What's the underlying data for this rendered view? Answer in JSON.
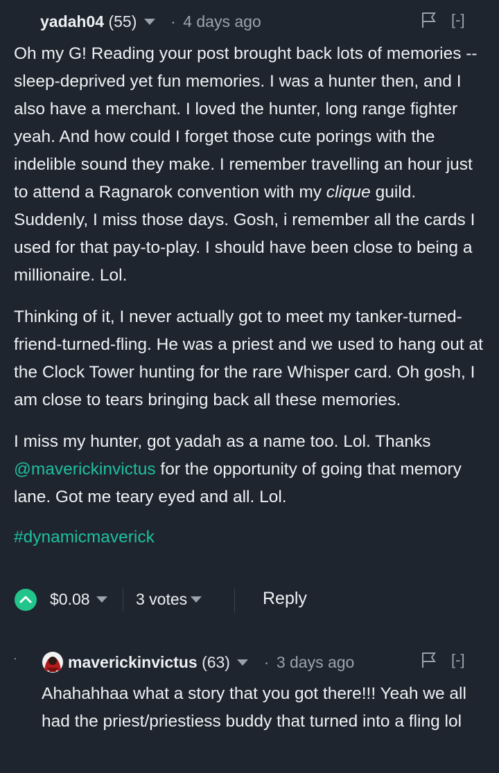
{
  "comment": {
    "author": "yadah04",
    "reputation": "(55)",
    "separator": "·",
    "time": "4 days ago",
    "collapse_label": "[-]",
    "paragraph1_before_italic": "Oh my G! Reading your post brought back lots of memories -- sleep-deprived yet fun memories. I was a hunter then, and I also have a merchant. I loved the hunter, long range fighter yeah. And how could I forget those cute porings with the indelible sound they make. I remember travelling an hour just to attend a Ragnarok convention with my ",
    "paragraph1_italic": "clique",
    "paragraph1_after_italic": " guild. Suddenly, I miss those days. Gosh, i remember all the cards I used for that pay-to-play. I should have been close to being a millionaire. Lol.",
    "paragraph2": "Thinking of it, I never actually got to meet my tanker-turned-friend-turned-fling. He was a priest and we used to hang out at the Clock Tower hunting for the rare Whisper card. Oh gosh, I am close to tears bringing back all these memories.",
    "paragraph3_before": "I miss my hunter, got yadah as a name too. Lol. Thanks ",
    "paragraph3_mention": "@maverickinvictus",
    "paragraph3_after": " for the opportunity of going that memory lane. Got me teary eyed and all. Lol.",
    "hashtag": "#dynamicmaverick",
    "payout": "$0.08",
    "votes": "3 votes",
    "reply_label": "Reply"
  },
  "reply": {
    "author": "maverickinvictus",
    "reputation": "(63)",
    "separator": "·",
    "time": "3 days ago",
    "collapse_label": "[-]",
    "thread_dot": "·",
    "text": "Ahahahhaa what a story that you got there!!! Yeah we all had the priest/priestiess buddy that turned into a fling lol"
  },
  "colors": {
    "background": "#1f252f",
    "text": "#eef1f4",
    "muted": "#9aa3ad",
    "accent": "#1fbf9f",
    "upvote": "#21c58c"
  },
  "icons": [
    "chevron-down-icon",
    "flag-icon",
    "upvote-chevron-icon",
    "avatar"
  ]
}
